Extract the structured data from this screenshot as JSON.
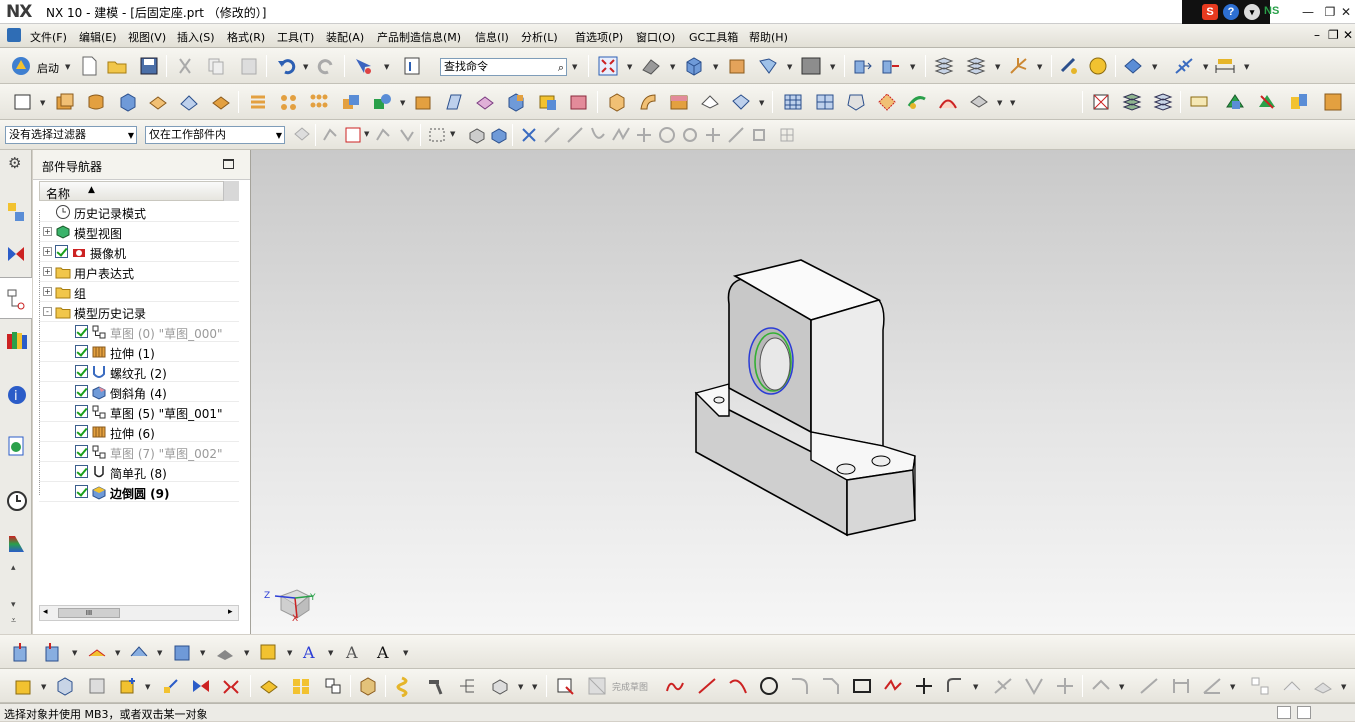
{
  "app": {
    "logo": "NX",
    "title": "NX 10 - 建模 - [后固定座.prt （修改的）]",
    "tray_label": "NS"
  },
  "menu": {
    "items": [
      "文件(F)",
      "编辑(E)",
      "视图(V)",
      "插入(S)",
      "格式(R)",
      "工具(T)",
      "装配(A)",
      "产品制造信息(M)",
      "信息(I)",
      "分析(L)",
      "首选项(P)",
      "窗口(O)",
      "GC工具箱",
      "帮助(H)"
    ]
  },
  "toolbar": {
    "start_label": "启动",
    "search_placeholder": "查找命令",
    "filter_value": "没有选择过滤器",
    "scope_value": "仅在工作部件内",
    "finish_sketch_label": "完成草图"
  },
  "navigator": {
    "title": "部件导航器",
    "column_name": "名称",
    "items": [
      {
        "label": "历史记录模式",
        "level": 0,
        "expand": "",
        "icon": "clock",
        "check": false,
        "grey": false,
        "bold": false
      },
      {
        "label": "模型视图",
        "level": 0,
        "expand": "+",
        "icon": "views",
        "check": false,
        "grey": false,
        "bold": false
      },
      {
        "label": "摄像机",
        "level": 0,
        "expand": "+",
        "icon": "camera",
        "check": true,
        "grey": false,
        "bold": false
      },
      {
        "label": "用户表达式",
        "level": 0,
        "expand": "+",
        "icon": "folder",
        "check": false,
        "grey": false,
        "bold": false
      },
      {
        "label": "组",
        "level": 0,
        "expand": "+",
        "icon": "folder",
        "check": false,
        "grey": false,
        "bold": false
      },
      {
        "label": "模型历史记录",
        "level": 0,
        "expand": "-",
        "icon": "folder",
        "check": false,
        "grey": false,
        "bold": false
      },
      {
        "label": "草图 (0) \"草图_000\"",
        "level": 1,
        "icon": "sketch",
        "check": true,
        "grey": true,
        "bold": false
      },
      {
        "label": "拉伸 (1)",
        "level": 1,
        "icon": "extrude",
        "check": true,
        "grey": false,
        "bold": false
      },
      {
        "label": "螺纹孔 (2)",
        "level": 1,
        "icon": "hole",
        "check": true,
        "grey": false,
        "bold": false
      },
      {
        "label": "倒斜角 (4)",
        "level": 1,
        "icon": "chamfer",
        "check": true,
        "grey": false,
        "bold": false
      },
      {
        "label": "草图 (5) \"草图_001\"",
        "level": 1,
        "icon": "sketch",
        "check": true,
        "grey": false,
        "bold": false
      },
      {
        "label": "拉伸 (6)",
        "level": 1,
        "icon": "extrude",
        "check": true,
        "grey": false,
        "bold": false
      },
      {
        "label": "草图 (7) \"草图_002\"",
        "level": 1,
        "icon": "sketch",
        "check": true,
        "grey": true,
        "bold": false
      },
      {
        "label": "简单孔 (8)",
        "level": 1,
        "icon": "hole2",
        "check": true,
        "grey": false,
        "bold": false
      },
      {
        "label": "边倒圆 (9)",
        "level": 1,
        "icon": "blend",
        "check": true,
        "grey": false,
        "bold": true
      }
    ]
  },
  "viewport": {
    "triad": {
      "x": "X",
      "y": "Y",
      "z": "Z"
    }
  },
  "status": {
    "message": "选择对象并使用 MB3，或者双击某一对象"
  },
  "colors": {
    "accent": "#2f6db5",
    "selection_blue": "#2b3dd6",
    "selection_green": "#33b033"
  }
}
